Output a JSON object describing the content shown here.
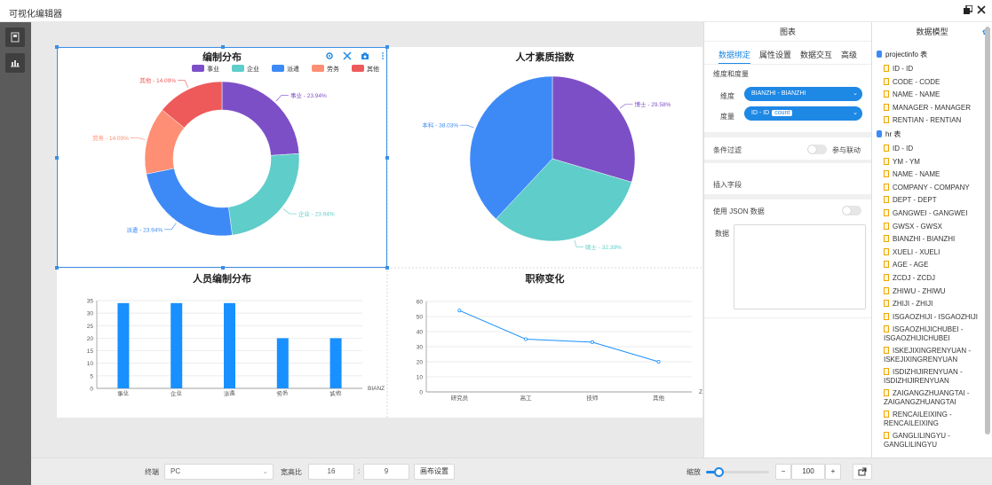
{
  "window": {
    "title": "可视化编辑器",
    "restore_icon": "restore-icon",
    "close_icon": "close-icon"
  },
  "leftbar": {
    "items": [
      {
        "icon": "page-icon"
      },
      {
        "icon": "chart-icon"
      }
    ]
  },
  "charts": {
    "c1": {
      "title": "编制分布"
    },
    "c2": {
      "title": "人才素质指数"
    },
    "c3": {
      "title": "人员编制分布"
    },
    "c4": {
      "title": "职称变化"
    }
  },
  "chart_data": [
    {
      "type": "pie",
      "variant": "donut",
      "title": "编制分布",
      "legend": [
        "事业",
        "企业",
        "派遣",
        "劳务",
        "其他"
      ],
      "legend_position": "top",
      "categories": [
        "事业",
        "企业",
        "派遣",
        "劳务",
        "其他"
      ],
      "values": [
        23.94,
        23.94,
        23.94,
        14.09,
        14.09
      ],
      "labels": [
        "事业 - 23.94%",
        "企业 - 23.94%",
        "派遣 - 23.94%",
        "劳务 - 14.09%",
        "其他 - 14.09%"
      ],
      "colors": [
        "#7d4fc7",
        "#5fcdc9",
        "#3d8af7",
        "#ff8f74",
        "#ee5a5a"
      ]
    },
    {
      "type": "pie",
      "title": "人才素质指数",
      "categories": [
        "博士",
        "硕士",
        "本科"
      ],
      "values": [
        29.58,
        32.39,
        38.03
      ],
      "labels": [
        "博士 - 29.58%",
        "硕士 - 32.39%",
        "本科 - 38.03%"
      ],
      "colors": [
        "#7d4fc7",
        "#5fcdc9",
        "#3d8af7"
      ]
    },
    {
      "type": "bar",
      "title": "人员编制分布",
      "categories": [
        "事业",
        "企业",
        "派遣",
        "劳务",
        "其他"
      ],
      "values": [
        34,
        34,
        34,
        20,
        20
      ],
      "ylim": [
        0,
        35
      ],
      "yticks": [
        0,
        5,
        10,
        15,
        20,
        25,
        30,
        35
      ],
      "xlabel": "BIANZ",
      "color": "#1890ff",
      "grid": true
    },
    {
      "type": "line",
      "title": "职称变化",
      "categories": [
        "研究员",
        "高工",
        "技师",
        "其他"
      ],
      "values": [
        54,
        35,
        33,
        20
      ],
      "ylim": [
        0,
        60
      ],
      "yticks": [
        0,
        10,
        20,
        30,
        40,
        50,
        60
      ],
      "xlabel": "Z",
      "color": "#1890ff",
      "grid": true
    }
  ],
  "cell_tools": [
    "settings-icon",
    "fullscreen-icon",
    "camera-icon",
    "more-icon"
  ],
  "bottom": {
    "terminal_label": "终端",
    "terminal_value": "PC",
    "ratio_label": "宽高比",
    "ratio_w": "16",
    "ratio_sep": ":",
    "ratio_h": "9",
    "canvas_btn": "画布设置",
    "zoom_label": "缩放",
    "zoom_minus": "−",
    "zoom_value": "100",
    "zoom_plus": "+",
    "zoom_level": 0.2
  },
  "rpanel": {
    "title": "图表",
    "tabs": [
      "数据绑定",
      "属性设置",
      "数据交互",
      "高级"
    ],
    "section_dims": "维度和度量",
    "dim_label": "维度",
    "dim_value": "BIANZHI - BIANZHI",
    "measure_label": "度量",
    "measure_value": "ID - ID",
    "measure_tag": "count",
    "filter_label": "条件过滤",
    "link_label": "参与联动",
    "insert_field": "插入字段",
    "json_label": "使用 JSON 数据",
    "data_label": "数据"
  },
  "mpanel": {
    "title": "数据模型",
    "groups": [
      {
        "name": "projectinfo 表",
        "items": [
          "ID - ID",
          "CODE - CODE",
          "NAME - NAME",
          "MANAGER - MANAGER",
          "RENTIAN - RENTIAN"
        ]
      },
      {
        "name": "hr 表",
        "items": [
          "ID - ID",
          "YM - YM",
          "NAME - NAME",
          "COMPANY - COMPANY",
          "DEPT - DEPT",
          "GANGWEI - GANGWEI",
          "GWSX - GWSX",
          "BIANZHI - BIANZHI",
          "XUELI - XUELI",
          "AGE - AGE",
          "ZCDJ - ZCDJ",
          "ZHIWU - ZHIWU",
          "ZHIJI - ZHIJI",
          "ISGAOZHIJI - ISGAOZHIJI",
          "ISGAOZHIJICHUBEI - ISGAOZHIJICHUBEI",
          "ISKEJIXINGRENYUAN - ISKEJIXINGRENYUAN",
          "ISDIZHIJIRENYUAN - ISDIZHIJIRENYUAN",
          "ZAIGANGZHUANGTAI - ZAIGANGZHUANGTAI",
          "RENCAILEIXING - RENCAILEIXING",
          "GANGLILINGYU - GANGLILINGYU"
        ]
      }
    ]
  }
}
